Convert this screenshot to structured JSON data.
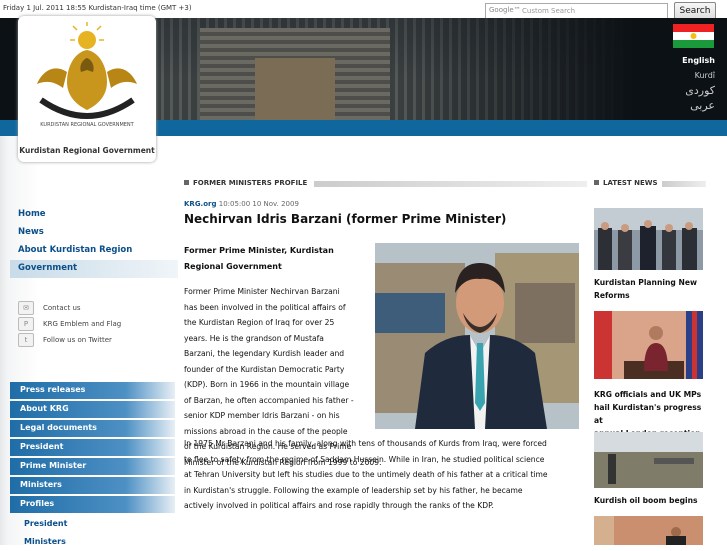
{
  "topbar": {
    "datetime": "Friday 1 Jul. 2011   18:55 Kurdistan-Iraq time (GMT +3)"
  },
  "search": {
    "brand": "Google™",
    "placeholder": "Custom Search",
    "button": "Search"
  },
  "header": {
    "org_name": "Kurdistan Regional Government",
    "emblem_text": "KURDISTAN REGIONAL GOVERNMENT",
    "languages": [
      "English",
      "Kurdî",
      "کوردی",
      "عربی"
    ],
    "active_language": "English"
  },
  "nav_primary": [
    "Home",
    "News",
    "About Kurdistan Region",
    "Government"
  ],
  "nav_primary_active": "Government",
  "contact_links": [
    {
      "label": "Contact us",
      "icon": "envelope-icon"
    },
    {
      "label": "KRG Emblem and Flag",
      "icon": "emblem-icon"
    },
    {
      "label": "Follow us on Twitter",
      "icon": "twitter-icon"
    }
  ],
  "nav_secondary": [
    "Press releases",
    "About KRG",
    "Legal documents",
    "President",
    "Prime Minister",
    "Ministers",
    "Profiles"
  ],
  "nav_secondary_sub": [
    "President",
    "Ministers"
  ],
  "section": {
    "label": "FORMER MINISTERS PROFILE"
  },
  "article": {
    "source": "KRG.org",
    "timestamp": "10:05:00 10 Nov. 2009",
    "title": "Nechirvan Idris Barzani (former Prime Minister)",
    "subtitle_lines": [
      "Former Prime Minister, Kurdistan",
      "Regional Government"
    ],
    "para1_lines": [
      "Former Prime Minister Nechirvan Barzani",
      "has been involved in the political affairs of",
      "the Kurdistan Region of Iraq for over 25",
      "years. He is the grandson of Mustafa",
      "Barzani, the legendary Kurdish leader and",
      "founder of the Kurdistan Democratic Party",
      "(KDP). Born in 1966 in the mountain village",
      "of Barzan, he often accompanied his father -",
      "senior KDP member Idris Barzani - on his",
      "missions abroad in the cause of the people",
      "of the Kurdistan Region. He served as Prime",
      "Minister of the Kurdistan Region from 1999 to 2009."
    ],
    "para2_lines": [
      "In 1975 Mr Barzani and his family, along with tens of thousands of Kurds from Iraq, were forced",
      "to flee to safety from the regime of Saddam Hussein. While in Iran, he studied political science",
      "at Tehran University but left his studies due to the untimely death of his father at a critical time",
      "in Kurdistan's struggle. Following the example of leadership set by his father, he became",
      "actively involved in political affairs and rose rapidly through the ranks of the KDP."
    ]
  },
  "latest_news": {
    "label": "LATEST NEWS",
    "items": [
      {
        "caption_lines": [
          "Kurdistan Planning New",
          "Reforms"
        ]
      },
      {
        "caption_lines": [
          "KRG officials and UK MPs",
          "hail Kurdistan's progress at",
          "annual London reception"
        ]
      },
      {
        "caption_lines": [
          "Kurdish oil boom begins"
        ]
      }
    ]
  },
  "colors": {
    "header_bg": "#0c1116",
    "blue_band": "#10679e",
    "link_blue": "#0b4f8a",
    "nav_gradient": "#1f6da7"
  }
}
